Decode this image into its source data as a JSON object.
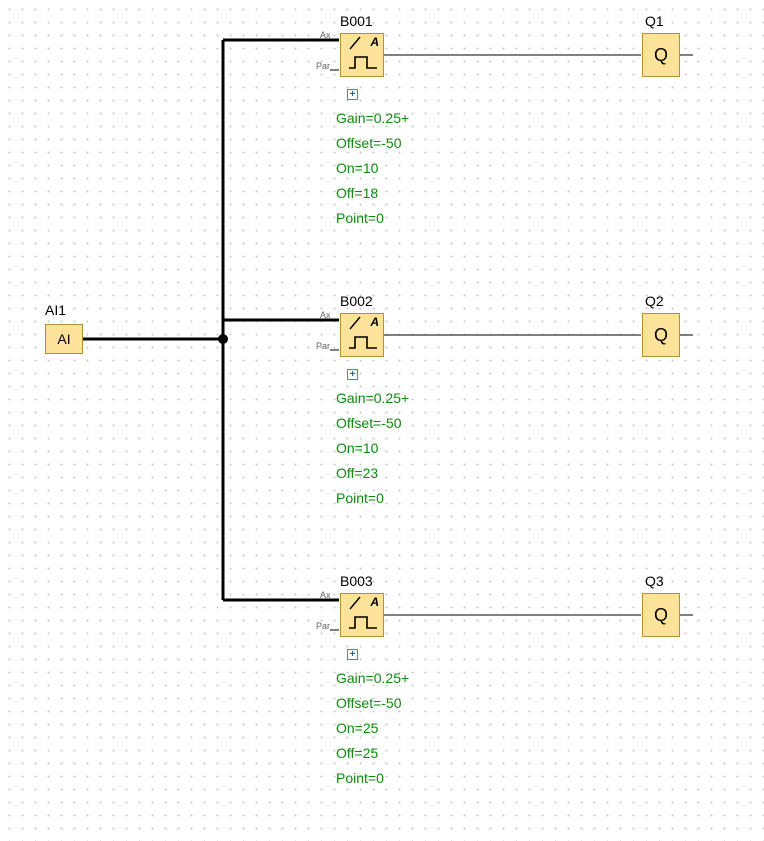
{
  "input": {
    "name": "AI1",
    "symbol": "AI"
  },
  "functions": [
    {
      "name": "B001",
      "pins": {
        "ax": "Ax",
        "par": "Par"
      },
      "icon_letter": "A",
      "expand_symbol": "+",
      "params": {
        "gain": "Gain=0.25+",
        "offset": "Offset=-50",
        "on": "On=10",
        "off": "Off=18",
        "point": "Point=0"
      }
    },
    {
      "name": "B002",
      "pins": {
        "ax": "Ax",
        "par": "Par"
      },
      "icon_letter": "A",
      "expand_symbol": "+",
      "params": {
        "gain": "Gain=0.25+",
        "offset": "Offset=-50",
        "on": "On=10",
        "off": "Off=23",
        "point": "Point=0"
      }
    },
    {
      "name": "B003",
      "pins": {
        "ax": "Ax",
        "par": "Par"
      },
      "icon_letter": "A",
      "expand_symbol": "+",
      "params": {
        "gain": "Gain=0.25+",
        "offset": "Offset=-50",
        "on": "On=25",
        "off": "Off=25",
        "point": "Point=0"
      }
    }
  ],
  "outputs": [
    {
      "name": "Q1",
      "symbol": "Q"
    },
    {
      "name": "Q2",
      "symbol": "Q"
    },
    {
      "name": "Q3",
      "symbol": "Q"
    }
  ],
  "chart_data": {
    "type": "diagram",
    "description": "PLC/LOGO function block diagram: one analog input feeds three analog threshold trigger blocks, each driving a digital output.",
    "nodes": [
      {
        "id": "AI1",
        "kind": "analog-input",
        "label": "AI"
      },
      {
        "id": "B001",
        "kind": "analog-threshold-trigger",
        "gain": 0.25,
        "offset": -50,
        "on": 10,
        "off": 18,
        "point": 0
      },
      {
        "id": "B002",
        "kind": "analog-threshold-trigger",
        "gain": 0.25,
        "offset": -50,
        "on": 10,
        "off": 23,
        "point": 0
      },
      {
        "id": "B003",
        "kind": "analog-threshold-trigger",
        "gain": 0.25,
        "offset": -50,
        "on": 25,
        "off": 25,
        "point": 0
      },
      {
        "id": "Q1",
        "kind": "digital-output",
        "label": "Q"
      },
      {
        "id": "Q2",
        "kind": "digital-output",
        "label": "Q"
      },
      {
        "id": "Q3",
        "kind": "digital-output",
        "label": "Q"
      }
    ],
    "edges": [
      {
        "from": "AI1",
        "to": "B001",
        "to_pin": "Ax"
      },
      {
        "from": "AI1",
        "to": "B002",
        "to_pin": "Ax"
      },
      {
        "from": "AI1",
        "to": "B003",
        "to_pin": "Ax"
      },
      {
        "from": "B001",
        "to": "Q1"
      },
      {
        "from": "B002",
        "to": "Q2"
      },
      {
        "from": "B003",
        "to": "Q3"
      }
    ]
  }
}
